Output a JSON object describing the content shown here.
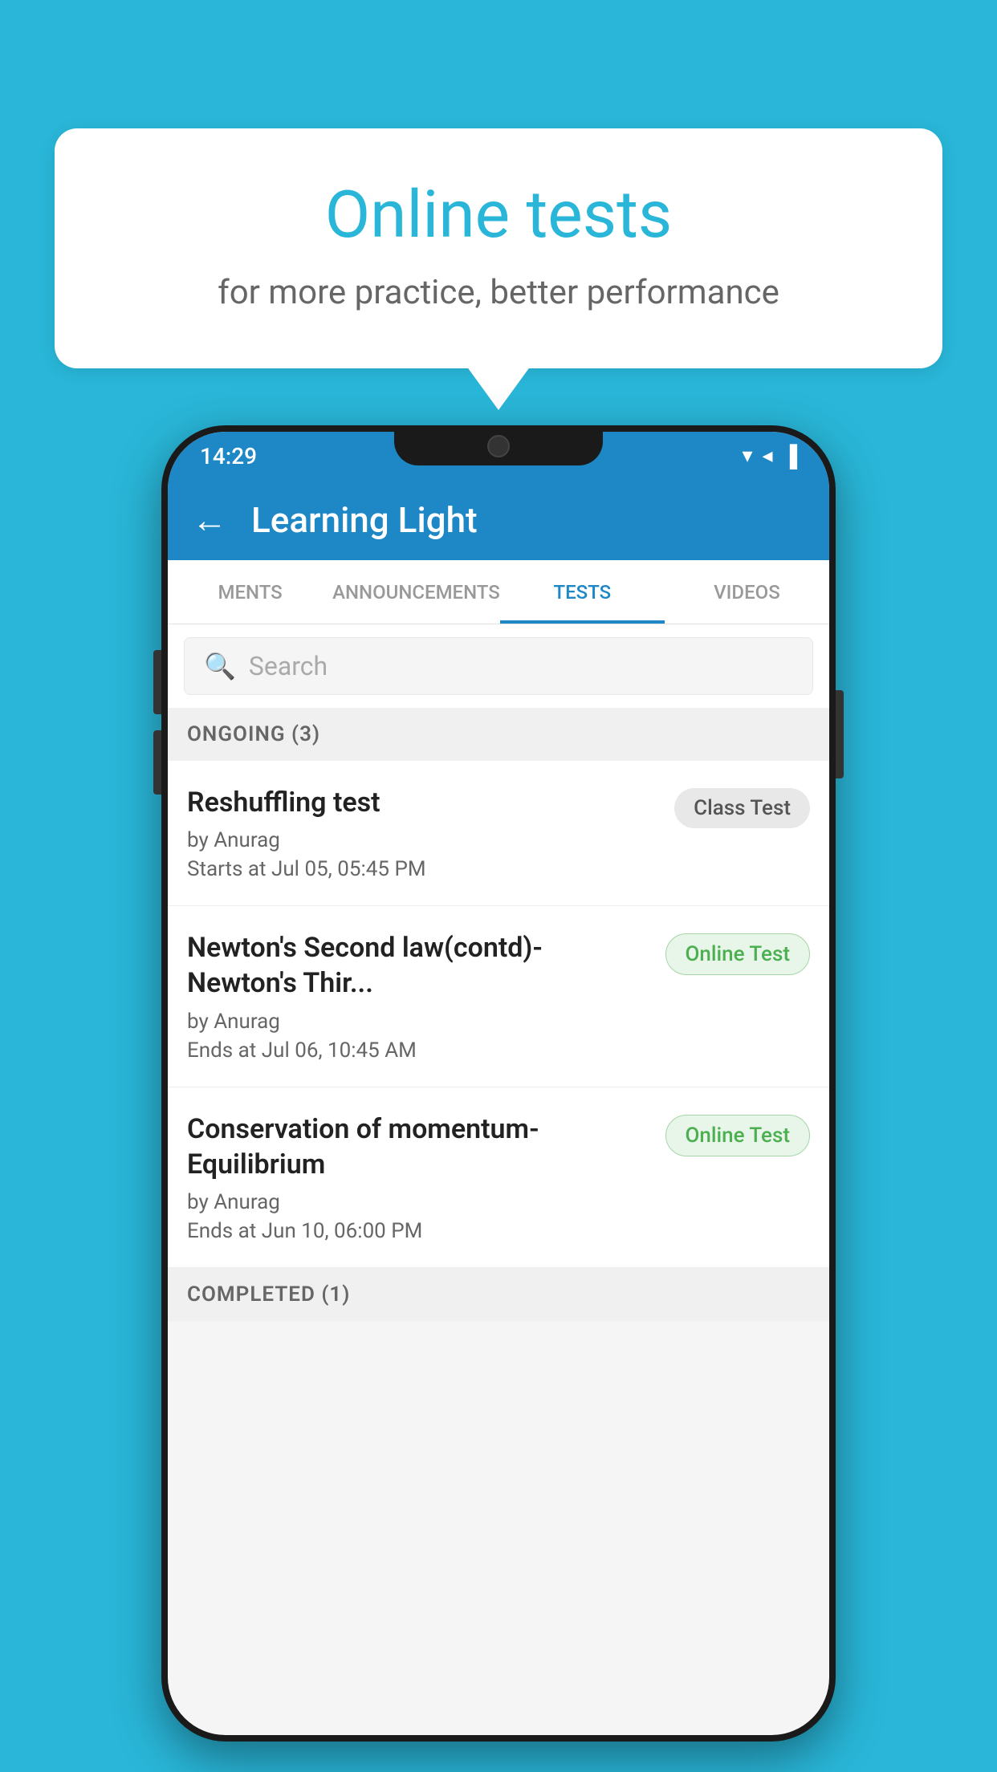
{
  "background_color": "#29b6d8",
  "speech_bubble": {
    "title": "Online tests",
    "subtitle": "for more practice, better performance"
  },
  "phone": {
    "status_bar": {
      "time": "14:29",
      "signal_icon": "▼",
      "network_icon": "◀",
      "battery_icon": "▐"
    },
    "app_bar": {
      "title": "Learning Light",
      "back_icon": "←"
    },
    "tabs": [
      {
        "label": "MENTS",
        "active": false
      },
      {
        "label": "ANNOUNCEMENTS",
        "active": false
      },
      {
        "label": "TESTS",
        "active": true
      },
      {
        "label": "VIDEOS",
        "active": false
      }
    ],
    "search": {
      "placeholder": "Search"
    },
    "ongoing_section": {
      "label": "ONGOING (3)"
    },
    "test_items": [
      {
        "name": "Reshuffling test",
        "author": "by Anurag",
        "date": "Starts at  Jul 05, 05:45 PM",
        "badge": "Class Test",
        "badge_type": "class"
      },
      {
        "name": "Newton's Second law(contd)-Newton's Thir...",
        "author": "by Anurag",
        "date": "Ends at  Jul 06, 10:45 AM",
        "badge": "Online Test",
        "badge_type": "online"
      },
      {
        "name": "Conservation of momentum-Equilibrium",
        "author": "by Anurag",
        "date": "Ends at  Jun 10, 06:00 PM",
        "badge": "Online Test",
        "badge_type": "online"
      }
    ],
    "completed_section": {
      "label": "COMPLETED (1)"
    }
  }
}
